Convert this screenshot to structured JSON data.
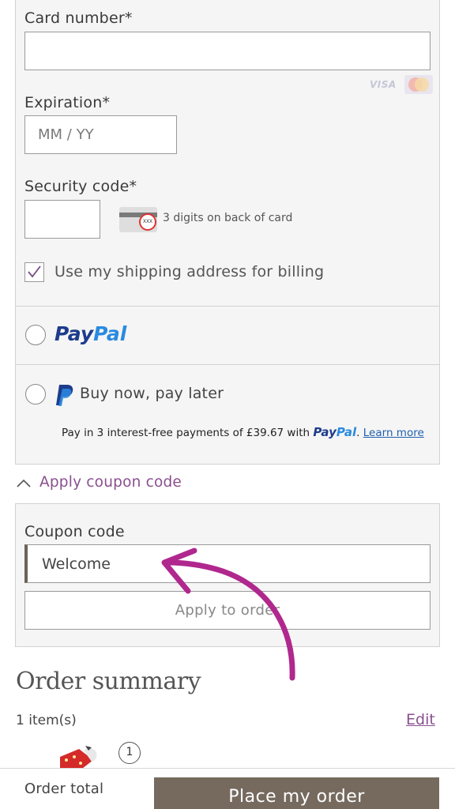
{
  "card": {
    "number_label": "Card number*",
    "number_value": "",
    "brand_visa": "VISA",
    "brand_mastercard": "mastercard-icon",
    "expiration_label": "Expiration*",
    "expiration_placeholder": "MM / YY",
    "security_label": "Security code*",
    "security_value": "",
    "security_icon_text": "XXX",
    "security_hint": "3 digits on back of card",
    "billing_checkbox_label": "Use my shipping address for billing",
    "billing_checked": true
  },
  "paypal": {
    "word_pay": "Pay",
    "word_pal": "Pal"
  },
  "bnpl": {
    "label": "Buy now, pay later",
    "installments_text": "Pay in 3 interest-free payments of £39.67 with ",
    "learn_more": "Learn more"
  },
  "coupon": {
    "toggle_label": "Apply coupon code",
    "field_label": "Coupon code",
    "field_value": "Welcome",
    "apply_button": "Apply to order"
  },
  "summary": {
    "title": "Order summary",
    "items_count": "1 item(s)",
    "edit": "Edit",
    "quantity": "1"
  },
  "footer": {
    "order_total_label": "Order total",
    "place_order": "Place my order"
  },
  "colors": {
    "accent_purple": "#8a4f8f",
    "annotation_magenta": "#b0288e",
    "place_order_bg": "#766a5f",
    "paypal_dark": "#1d3c8c",
    "paypal_light": "#2a8ae0"
  }
}
